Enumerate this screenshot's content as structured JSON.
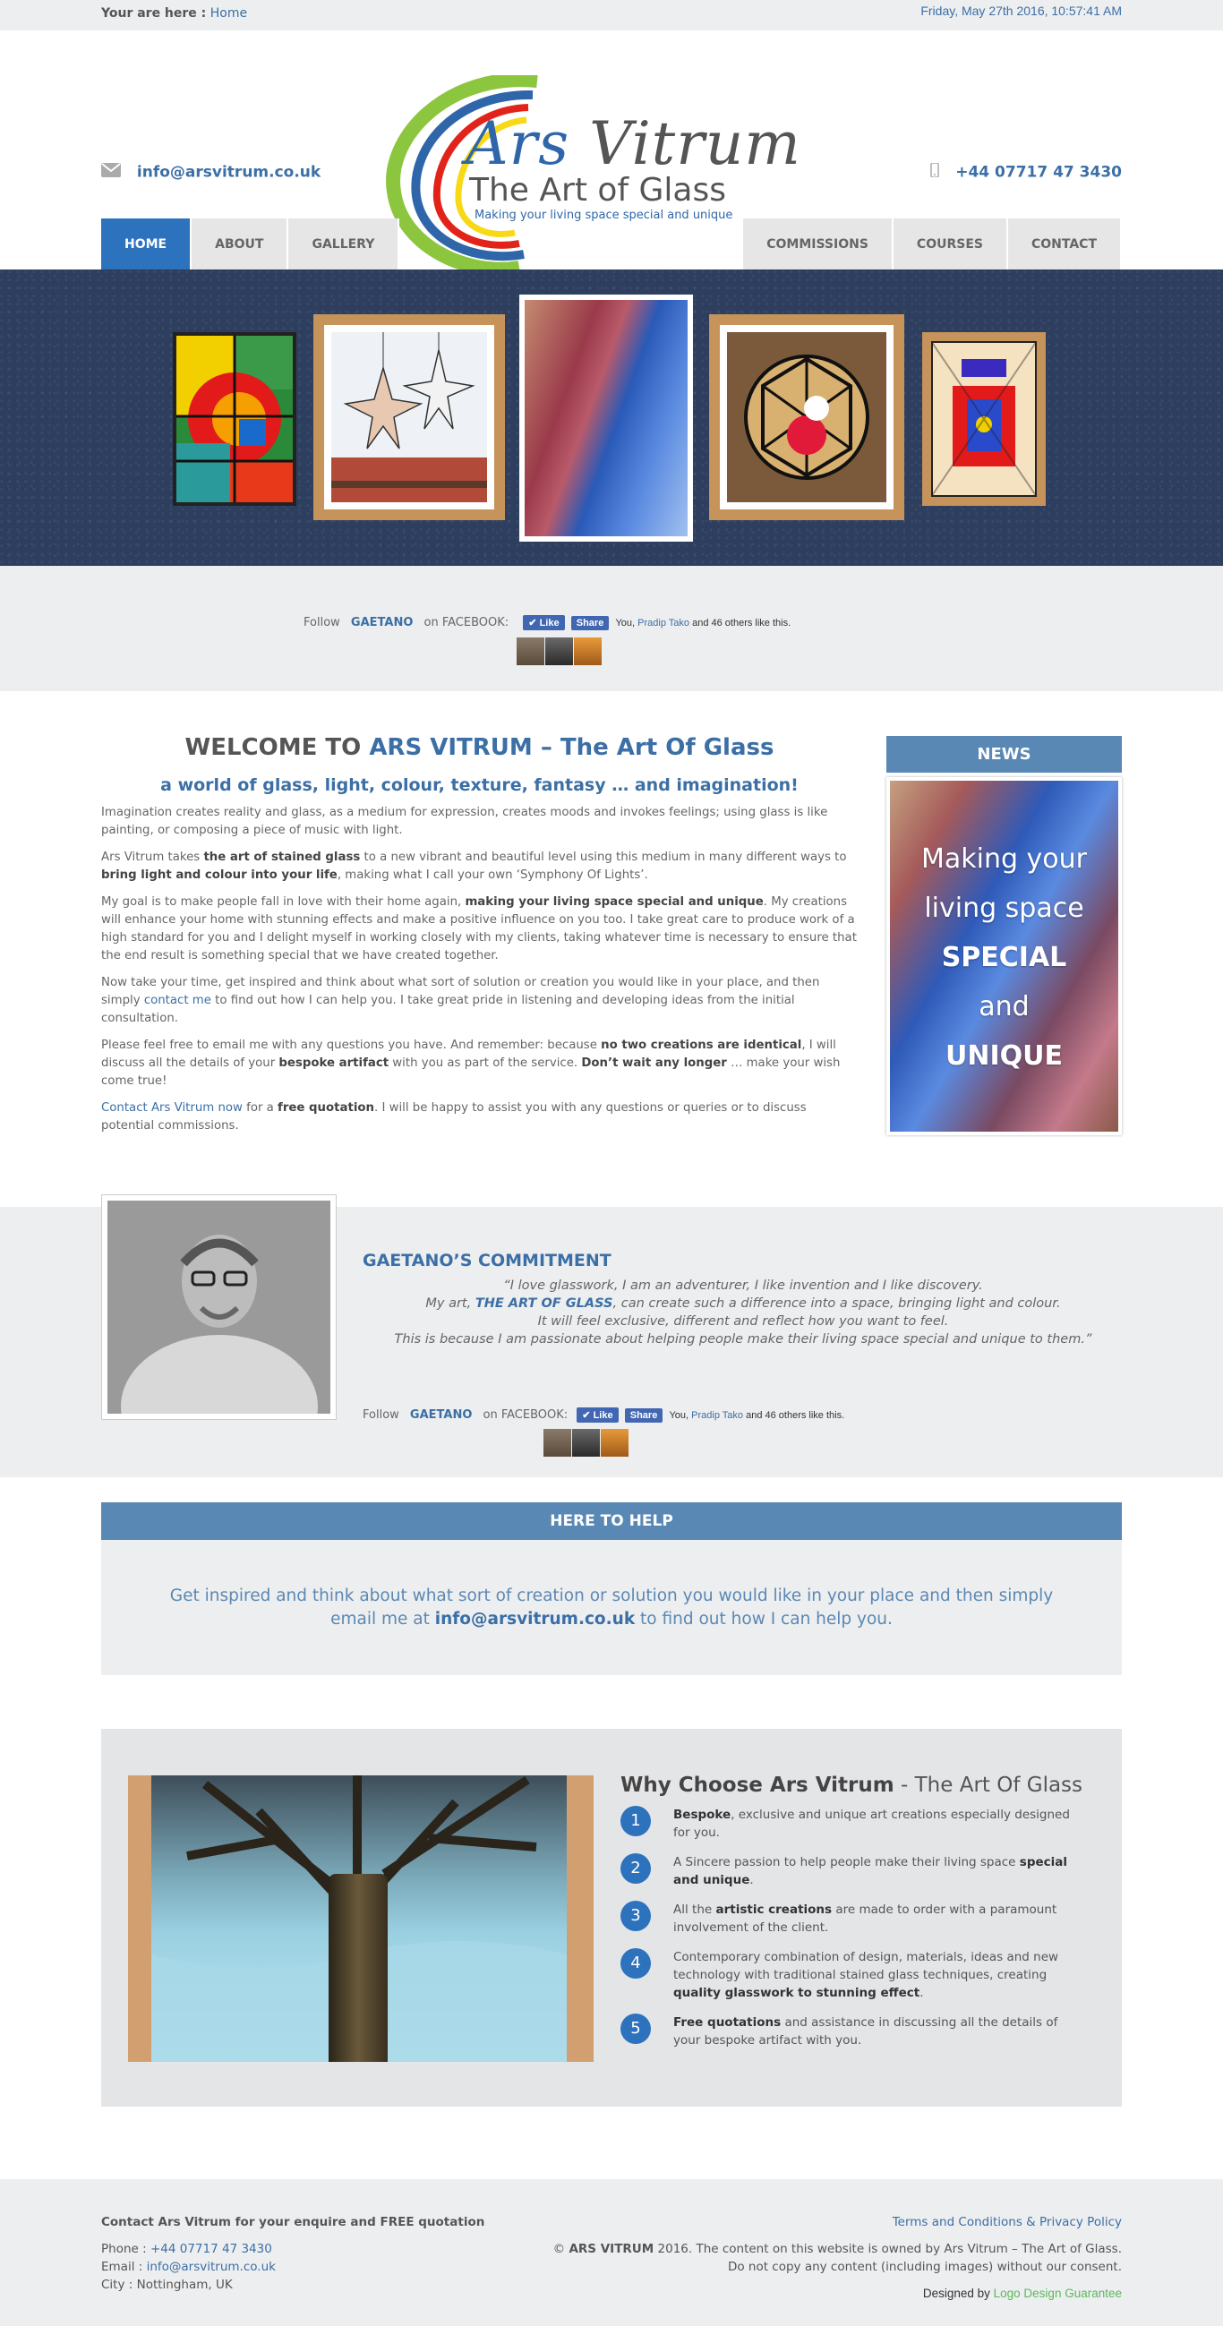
{
  "topbar": {
    "crumb_label": "Your are here :",
    "crumb_home": "Home",
    "date": "Friday, May 27th 2016, 10:57:41 AM"
  },
  "header": {
    "email": "info@arsvitrum.co.uk",
    "phone": "+44 07717 47 3430",
    "logo": {
      "line1_a": "Ars ",
      "line1_b": "Vitrum",
      "line2": "The Art of Glass",
      "tagline": "Making your living space special and unique"
    }
  },
  "nav": {
    "left": [
      "HOME",
      "ABOUT",
      "GALLERY"
    ],
    "right": [
      "COMMISSIONS",
      "COURSES",
      "CONTACT"
    ]
  },
  "follow": {
    "prefix": "Follow",
    "name": "GAETANO",
    "suffix": "on FACEBOOK:",
    "like": "Like",
    "share": "Share",
    "you": "You,",
    "friend": "Pradip Tako",
    "others": "and 46 others like this."
  },
  "welcome": {
    "title_a": "WELCOME TO ",
    "title_b": "ARS VITRUM – The Art Of Glass",
    "subtitle": "a world of glass, light, colour, texture, fantasy … and imagination!",
    "p1": "Imagination creates reality and glass, as a medium for expression, creates moods and invokes feelings; using glass is like painting, or composing a piece of music with light.",
    "p2_a": "Ars Vitrum takes ",
    "p2_b": "the art of stained glass",
    "p2_c": " to a new vibrant and beautiful level using this medium in many different ways to ",
    "p2_d": "bring light and colour into your life",
    "p2_e": ", making what I call your own ‘Symphony Of Lights’.",
    "p3_a": "My goal is to make people fall in love with their home again, ",
    "p3_b": "making your living space special and unique",
    "p3_c": ". My creations will enhance your home with stunning effects and make a positive influence on you too. I take great care to produce work of a high standard for you and I delight myself in working closely with my clients, taking whatever time is necessary to ensure that the end result is something special that we have created together.",
    "p4_a": "Now take your time, get inspired and think about what sort of solution or creation you would like in your place, and then simply ",
    "p4_link": "contact me",
    "p4_b": " to find out how I can help you. I take great pride in listening and developing ideas from the initial consultation.",
    "p5_a": "Please feel free to email me with any questions you have. And remember: because ",
    "p5_b": "no two creations are identical",
    "p5_c": ", I will discuss all the details of your ",
    "p5_d": "bespoke artifact",
    "p5_e": " with you as part of the service. ",
    "p5_f": "Don’t wait any longer",
    "p5_g": " … make your wish come true!",
    "p6_link": "Contact Ars Vitrum now",
    "p6_a": " for a ",
    "p6_b": "free quotation",
    "p6_c": ". I will be happy to assist you with any questions or queries or to discuss potential commissions."
  },
  "news": {
    "head": "NEWS",
    "l1": "Making your",
    "l2": "living space",
    "l3": "SPECIAL",
    "l4": "and",
    "l5": "UNIQUE"
  },
  "commitment": {
    "title": "GAETANO’S COMMITMENT",
    "q1": "“I love glasswork, I am an adventurer, I like invention and I like discovery.",
    "q2_a": "My art, ",
    "q2_b": "THE ART OF GLASS",
    "q2_c": ", can create such a difference into a space, bringing light and colour.",
    "q3": "It will feel exclusive, different and reflect how you want to feel.",
    "q4": "This is because I am passionate about helping people make their living space special and unique to them.”"
  },
  "help": {
    "head": "HERE TO HELP",
    "text_a": "Get inspired and think about what sort of creation or solution you would like in your place and then simply email me at ",
    "email": "info@arsvitrum.co.uk",
    "text_b": " to find out how I can help you."
  },
  "why": {
    "title_a": "Why Choose Ars Vitrum",
    "title_b": " - The Art Of Glass",
    "items": [
      {
        "n": "1",
        "a": "",
        "b": "Bespoke",
        "c": ", exclusive and unique art creations especially designed for you.",
        "d": "",
        "e": ""
      },
      {
        "n": "2",
        "a": "A Sincere passion to help people make their living space ",
        "b": "special and unique",
        "c": ".",
        "d": "",
        "e": ""
      },
      {
        "n": "3",
        "a": "All the ",
        "b": "artistic creations",
        "c": " are made to order with a paramount involvement of the client.",
        "d": "",
        "e": ""
      },
      {
        "n": "4",
        "a": "Contemporary combination of design, materials, ideas and new technology with traditional stained glass techniques, creating ",
        "b": "quality glasswork to stunning effect",
        "c": ".",
        "d": "",
        "e": ""
      },
      {
        "n": "5",
        "a": "",
        "b": "Free quotations",
        "c": " and assistance in discussing all the details of your bespoke artifact with you.",
        "d": "",
        "e": ""
      }
    ]
  },
  "footer": {
    "head": "Contact Ars Vitrum for your enquire and FREE quotation",
    "phone_label": "Phone :",
    "phone": "+44 07717 47 3430",
    "email_label": "Email :",
    "email": "info@arsvitrum.co.uk",
    "city": "City : Nottingham, UK",
    "terms": "Terms and Conditions & Privacy Policy",
    "copy_a": "© ",
    "copy_b": "ARS VITRUM",
    "copy_c": " 2016. The content on this website is owned by Ars Vitrum – The Art of Glass.",
    "copy_d": "Do not copy any content (including images) without our consent.",
    "designed": "Designed by ",
    "designer": "Logo Design Guarantee"
  },
  "colors": {
    "accent": "#3b6fa5",
    "nav_active": "#2d72bd",
    "panel_head": "#5a88b4",
    "banner": "#2d3e5e"
  }
}
